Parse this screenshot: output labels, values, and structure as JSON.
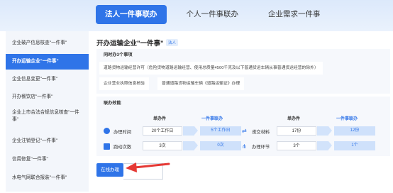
{
  "tabs": [
    {
      "label": "法人一件事联办"
    },
    {
      "label": "个人一件事联办"
    },
    {
      "label": "企业需求一件事"
    }
  ],
  "sidebar": {
    "items": [
      {
        "label": "企业破产信息核查\"一件事\""
      },
      {
        "label": "开办运输企业\"一件事\""
      },
      {
        "label": "企业信息变更\"一件事\""
      },
      {
        "label": "开办餐饮店\"一件事\""
      },
      {
        "label": "企业上市合法合规信息核查\"一件事\""
      },
      {
        "label": "企业注销登记\"一件事\""
      },
      {
        "label": "信用修复\"一件事\""
      },
      {
        "label": "水电气网联合报装\"一件事\""
      }
    ]
  },
  "main": {
    "title": "开办运输企业\"一件事\"",
    "tag": "法人",
    "matters_title": "同时办3个事项",
    "matters": [
      "道路货物运输经营许可（危险货物道路运输经营、使用总质量4500千克及以下普通货运车辆从事普通货运经营的除外）",
      "企业营业执照信息核验",
      "普通道路货物运输车辆《道路运输证》办理"
    ],
    "effect_title": "联办效能",
    "headers": {
      "single": "单办件",
      "joint": "一件事联办"
    },
    "rows_left": [
      {
        "icon": "clock-icon",
        "label": "办理时间",
        "single": "20个工作日",
        "joint": "5个工作日"
      },
      {
        "icon": "route-icon",
        "label": "跑动次数",
        "single": "3次",
        "joint": "0次"
      }
    ],
    "rows_right": [
      {
        "icon": "transfer-icon",
        "label": "递交材料",
        "single": "17份",
        "joint": "12份"
      },
      {
        "icon": "link-icon",
        "label": "办理环节",
        "single": "3个",
        "joint": "1个"
      }
    ],
    "button_label": "在线办理"
  },
  "colors": {
    "accent": "#2f74e8",
    "annotation": "#e53935"
  }
}
